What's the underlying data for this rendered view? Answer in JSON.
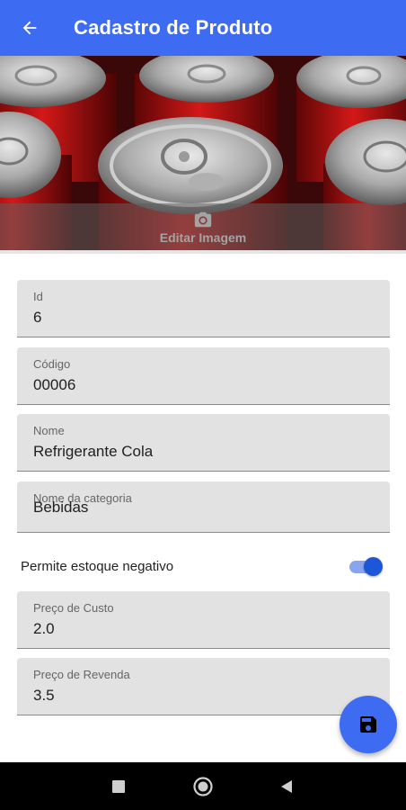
{
  "appbar": {
    "title": "Cadastro de Produto",
    "back_icon": "arrow-back-icon",
    "color": "#3d6cf2"
  },
  "image": {
    "edit_label": "Editar Imagem",
    "camera_icon": "camera-icon"
  },
  "fields": {
    "id": {
      "label": "Id",
      "value": "6"
    },
    "codigo": {
      "label": "Código",
      "value": "00006"
    },
    "nome": {
      "label": "Nome",
      "value": "Refrigerante Cola"
    },
    "categoria": {
      "label": "Nome da categoria",
      "value": "Bebidas"
    },
    "preco_custo": {
      "label": "Preço de Custo",
      "value": "2.0"
    },
    "preco_revenda": {
      "label": "Preço de Revenda",
      "value": "3.5"
    }
  },
  "estoque_negativo": {
    "label": "Permite estoque negativo",
    "enabled": true
  },
  "save_fab": {
    "icon": "save-icon"
  },
  "system_nav": {
    "icons": [
      "recents-square-icon",
      "home-circle-icon",
      "back-triangle-icon"
    ]
  }
}
